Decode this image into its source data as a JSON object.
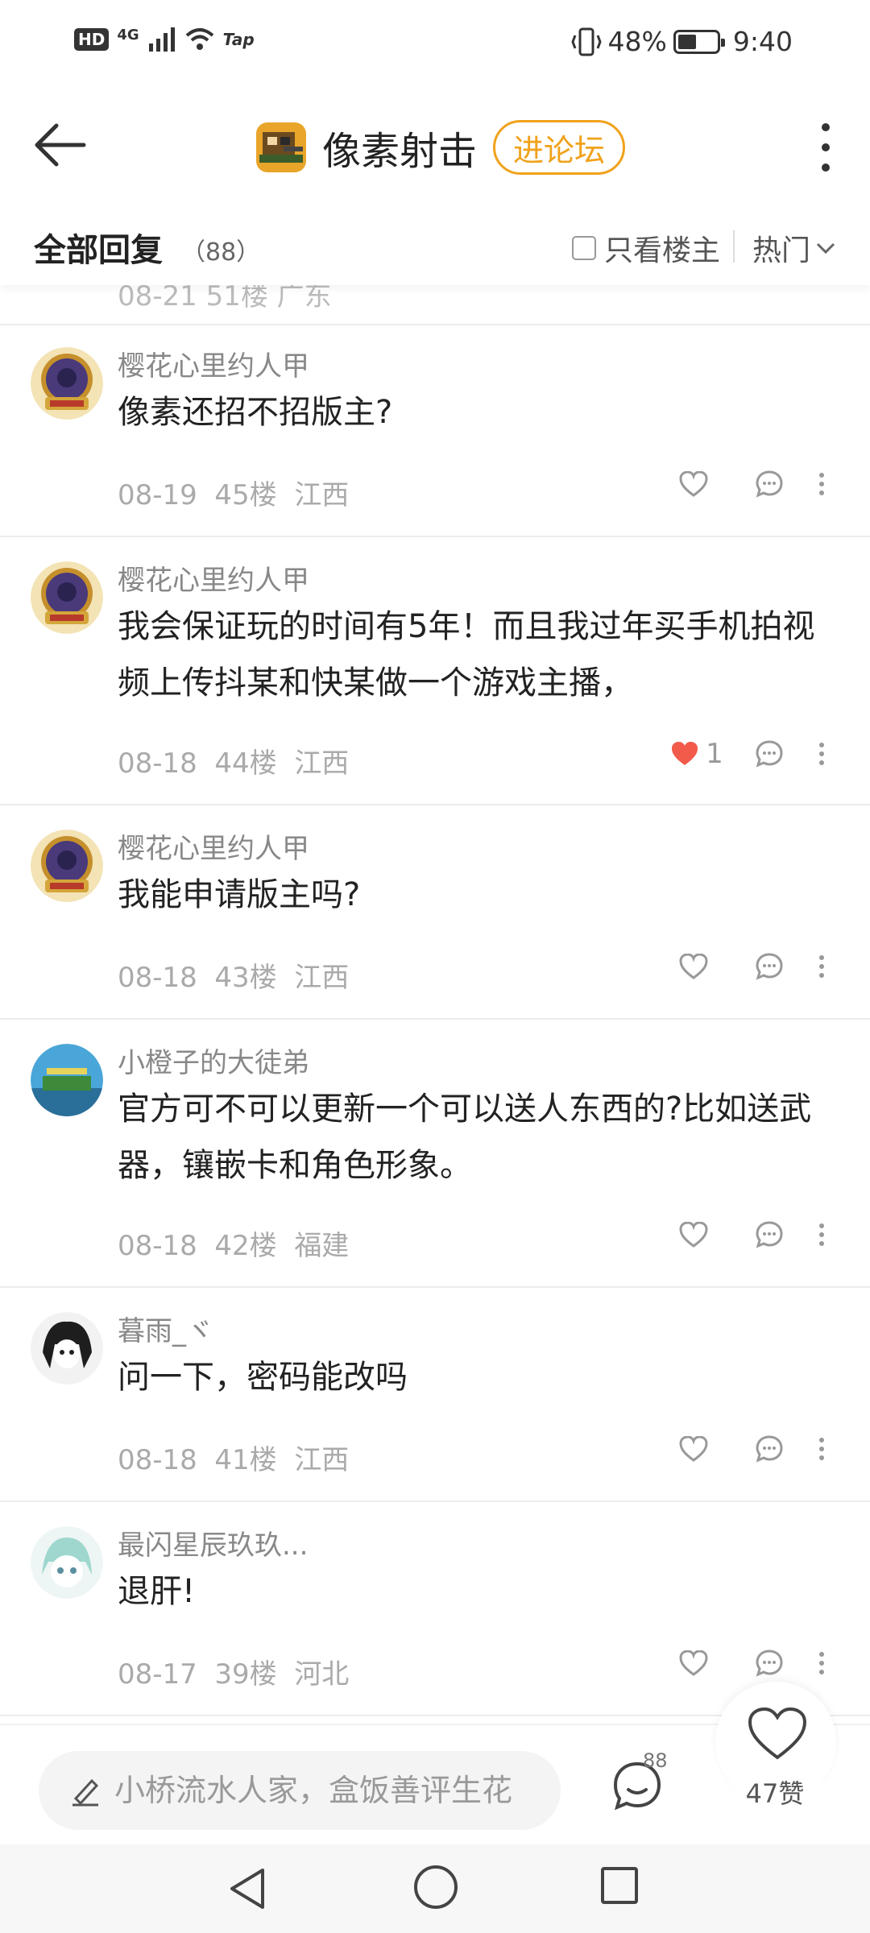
{
  "status_bar": {
    "hd": "HD",
    "network": "4G",
    "tap": "Tap",
    "battery": "48%",
    "battery_level": 0.48,
    "time": "9:40"
  },
  "header": {
    "title": "像素射击",
    "forum_button": "进论坛",
    "icons": [
      "back-arrow-icon",
      "game-icon",
      "more-vertical-icon"
    ]
  },
  "replies": {
    "title": "全部回复",
    "count": "（88）",
    "only_op": "只看楼主",
    "sort": "热门"
  },
  "partial_comment": {
    "meta": "08-21  51楼  广东"
  },
  "comments": [
    {
      "author": "樱花心里约人甲",
      "content": "像素还招不招版主?",
      "date": "08-19",
      "floor": "45楼",
      "region": "江西",
      "likes": "",
      "liked": false
    },
    {
      "author": "樱花心里约人甲",
      "content": "我会保证玩的时间有5年！而且我过年买手机拍视频上传抖某和快某做一个游戏主播，",
      "date": "08-18",
      "floor": "44楼",
      "region": "江西",
      "likes": "1",
      "liked": true
    },
    {
      "author": "樱花心里约人甲",
      "content": "我能申请版主吗?",
      "date": "08-18",
      "floor": "43楼",
      "region": "江西",
      "likes": "",
      "liked": false
    },
    {
      "author": "小橙子的大徒弟",
      "content": "官方可不可以更新一个可以送人东西的?比如送武器，镶嵌卡和角色形象。",
      "date": "08-18",
      "floor": "42楼",
      "region": "福建",
      "likes": "",
      "liked": false
    },
    {
      "author": "暮雨_ヾ",
      "content": "问一下，密码能改吗",
      "date": "08-18",
      "floor": "41楼",
      "region": "江西",
      "likes": "",
      "liked": false
    },
    {
      "author": "最闪星辰玖玖...",
      "content": "退肝!",
      "date": "08-17",
      "floor": "39楼",
      "region": "河北",
      "likes": "",
      "liked": false
    }
  ],
  "bottom_bar": {
    "placeholder": "小桥流水人家，盒饭善评生花",
    "comment_count": "88",
    "like_label": "47赞"
  },
  "colors": {
    "accent": "#f0a21b",
    "liked": "#f25a4a",
    "meta": "#aaaaaa"
  }
}
